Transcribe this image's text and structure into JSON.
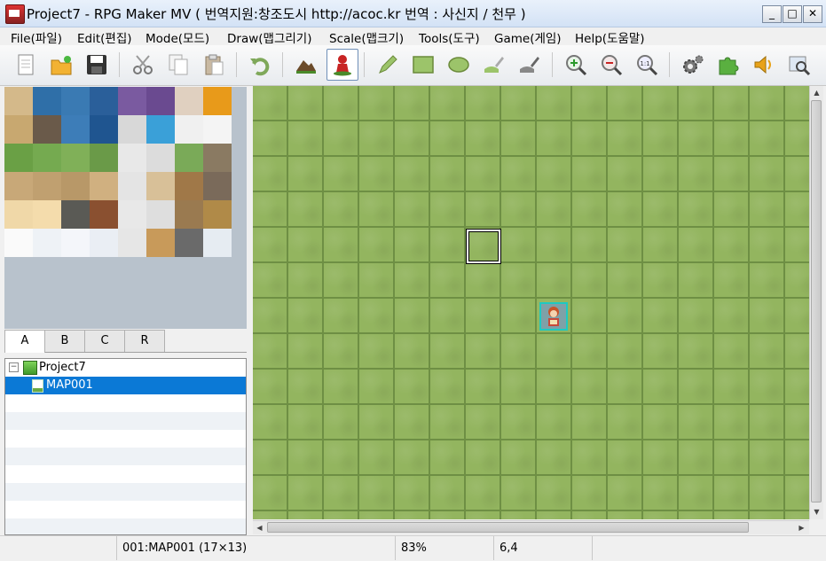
{
  "window": {
    "title": "Project7 - RPG Maker MV ( 번역지원:창조도시 http://acoc.kr 번역 : 사신지 / 천무 )",
    "minimize": "_",
    "maximize": "□",
    "close": "✕"
  },
  "menu": {
    "items": [
      "File(파일)",
      "Edit(편집)",
      "Mode(모드)",
      "Draw(맵그리기)",
      "Scale(맵크기)",
      "Tools(도구)",
      "Game(게임)",
      "Help(도움말)"
    ]
  },
  "toolbar": {
    "buttons": [
      "new-project-icon",
      "open-project-icon",
      "save-project-icon",
      "cut-icon",
      "copy-icon",
      "paste-icon",
      "undo-icon",
      "map-mode-icon",
      "event-mode-icon",
      "pencil-icon",
      "rectangle-icon",
      "ellipse-icon",
      "flood-fill-icon",
      "shadow-pen-icon",
      "zoom-in-icon",
      "zoom-out-icon",
      "actual-size-icon",
      "database-icon",
      "plugin-manager-icon",
      "sound-test-icon",
      "event-searcher-icon"
    ],
    "active": "event-mode-icon"
  },
  "tileset_tabs": [
    "A",
    "B",
    "C",
    "R"
  ],
  "active_tab": "A",
  "tree": {
    "project": "Project7",
    "maps": [
      "MAP001"
    ],
    "selected": "MAP001"
  },
  "status": {
    "map": "001:MAP001 (17×13)",
    "zoom": "83%",
    "coords": "6,4"
  },
  "colors": {
    "grass": "#93b55f",
    "selection": "#0b79d6",
    "event_border": "#1ec9c2"
  }
}
